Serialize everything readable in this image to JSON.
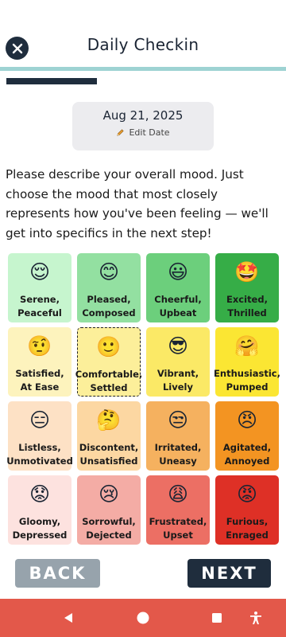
{
  "header": {
    "title": "Daily Checkin"
  },
  "progress": {
    "fraction": 0.33
  },
  "date_card": {
    "date": "Aug 21, 2025",
    "edit_label": "Edit Date"
  },
  "description": "Please describe your overall mood. Just choose the mood that most closely represents how you've been feeling — we'll get into specifics in the next step!",
  "moods": [
    {
      "emoji": "😌",
      "label": "Serene,\nPeaceful",
      "color": "#c6f5ce"
    },
    {
      "emoji": "😊",
      "label": "Pleased,\nComposed",
      "color": "#93e0a1"
    },
    {
      "emoji": "😃",
      "label": "Cheerful,\nUpbeat",
      "color": "#6ccf7c"
    },
    {
      "emoji": "🤩",
      "label": "Excited,\nThrilled",
      "color": "#36ad47"
    },
    {
      "emoji": "🤨",
      "label": "Satisfied,\nAt Ease",
      "color": "#fdf3bd"
    },
    {
      "emoji": "🙂",
      "label": "Comfortable,\nSettled",
      "color": "#fcef9a",
      "selected": true
    },
    {
      "emoji": "😎",
      "label": "Vibrant,\nLively",
      "color": "#fbe966"
    },
    {
      "emoji": "🤗",
      "label": "Enthusiastic,\nPumped",
      "color": "#fbe633"
    },
    {
      "emoji": "😑",
      "label": "Listless,\nUnmotivated",
      "color": "#fde1c5"
    },
    {
      "emoji": "🤔",
      "label": "Discontent,\nUnsatisfied",
      "color": "#fcd7a2"
    },
    {
      "emoji": "😒",
      "label": "Irritated,\nUneasy",
      "color": "#f5b15f"
    },
    {
      "emoji": "😠",
      "label": "Agitated,\nAnnoyed",
      "color": "#f39422"
    },
    {
      "emoji": "😟",
      "label": "Gloomy,\nDepressed",
      "color": "#fde2df"
    },
    {
      "emoji": "😢",
      "label": "Sorrowful,\nDejected",
      "color": "#f4aca5"
    },
    {
      "emoji": "😩",
      "label": "Frustrated,\nUpset",
      "color": "#ec6f64"
    },
    {
      "emoji": "😡",
      "label": "Furious,\nEnraged",
      "color": "#de3026"
    }
  ],
  "buttons": {
    "back": "BACK",
    "next": "NEXT"
  },
  "colors": {
    "accent": "#1f2d3d",
    "navbar": "#e3584a",
    "teal": "#9ed3d3"
  },
  "icons": {
    "close": "close-icon",
    "edit": "pencil-icon",
    "nav_back": "triangle-back-icon",
    "nav_home": "circle-home-icon",
    "nav_recents": "square-recents-icon",
    "nav_accessibility": "accessibility-icon"
  }
}
